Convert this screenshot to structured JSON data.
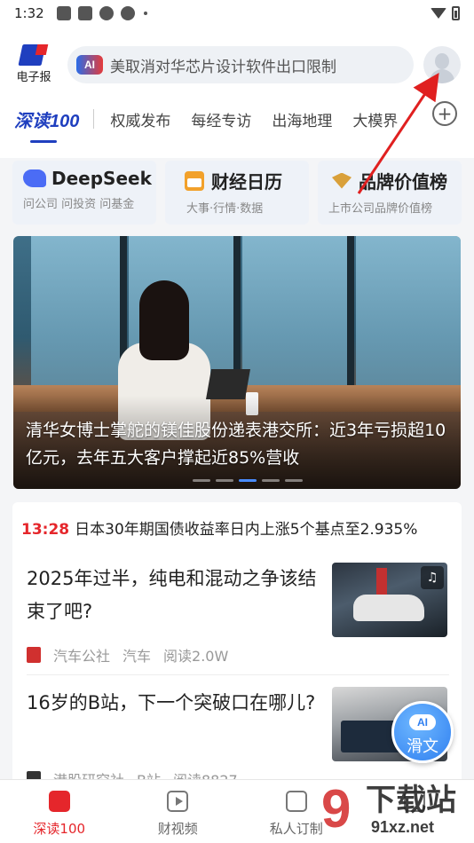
{
  "status_bar": {
    "time": "1:32"
  },
  "header": {
    "logo_text": "电子报",
    "search_ai_badge": "AI",
    "search_placeholder": "美取消对华芯片设计软件出口限制"
  },
  "tabs": {
    "main_label": "深读",
    "main_num": "100",
    "items": [
      "权威发布",
      "每经专访",
      "出海地理",
      "大模界"
    ],
    "add_label": "+"
  },
  "quick_cards": [
    {
      "title": "DeepSeek",
      "subtitle": "问公司 问投资 问基金",
      "icon": "deepseek-icon"
    },
    {
      "title": "财经日历",
      "subtitle": "大事·行情·数据",
      "icon": "calendar-icon"
    },
    {
      "title": "品牌价值榜",
      "subtitle": "上市公司品牌价值榜",
      "icon": "brand-icon"
    }
  ],
  "banner": {
    "caption": "清华女博士掌舵的镁佳股份递表港交所：近3年亏损超10亿元，去年五大客户撑起近85%营收",
    "slide_count": 5,
    "active_slide": 3
  },
  "feed": {
    "flash": {
      "time": "13:28",
      "text": "日本30年期国债收益率日内上涨5个基点至2.935%"
    },
    "articles": [
      {
        "title": "2025年过半，纯电和混动之争该结束了吧?",
        "source": "汽车公社",
        "category": "汽车",
        "reads": "阅读2.0W"
      },
      {
        "title": "16岁的B站，下一个突破口在哪儿?",
        "source": "港股研究社",
        "category": "B站",
        "reads": "阅读8827"
      }
    ]
  },
  "ai_float": {
    "badge": "AI",
    "label": "滑文"
  },
  "bottom_nav": [
    {
      "label": "深读100"
    },
    {
      "label": "财视频"
    },
    {
      "label": "私人订制"
    },
    {
      "label": ""
    }
  ],
  "watermark": {
    "digit": "9",
    "text": "下载站",
    "url": "91xz.net"
  },
  "colors": {
    "brand_blue": "#1f3fbf",
    "accent_red": "#e5262b",
    "annotation_red": "#e02020"
  }
}
